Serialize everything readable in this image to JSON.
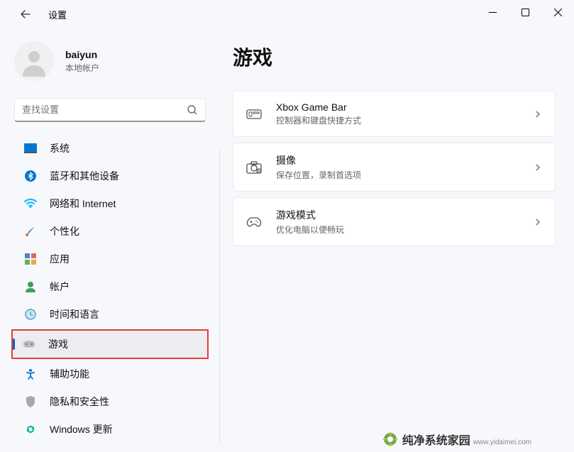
{
  "app": {
    "title": "设置"
  },
  "user": {
    "name": "baiyun",
    "subtitle": "本地帐户"
  },
  "search": {
    "placeholder": "查找设置"
  },
  "nav": {
    "system": {
      "label": "系统"
    },
    "bluetooth": {
      "label": "蓝牙和其他设备"
    },
    "network": {
      "label": "网络和 Internet"
    },
    "personal": {
      "label": "个性化"
    },
    "apps": {
      "label": "应用"
    },
    "accounts": {
      "label": "帐户"
    },
    "time": {
      "label": "时间和语言"
    },
    "gaming": {
      "label": "游戏"
    },
    "access": {
      "label": "辅助功能"
    },
    "privacy": {
      "label": "隐私和安全性"
    },
    "update": {
      "label": "Windows 更新"
    }
  },
  "page": {
    "title": "游戏"
  },
  "cards": {
    "xbox": {
      "title": "Xbox Game Bar",
      "sub": "控制器和键盘快捷方式"
    },
    "capture": {
      "title": "摄像",
      "sub": "保存位置，录制首选项"
    },
    "mode": {
      "title": "游戏模式",
      "sub": "优化电脑以便畅玩"
    }
  },
  "watermark": {
    "big": "纯净系统家园",
    "small": "www.yidaimei.com"
  }
}
